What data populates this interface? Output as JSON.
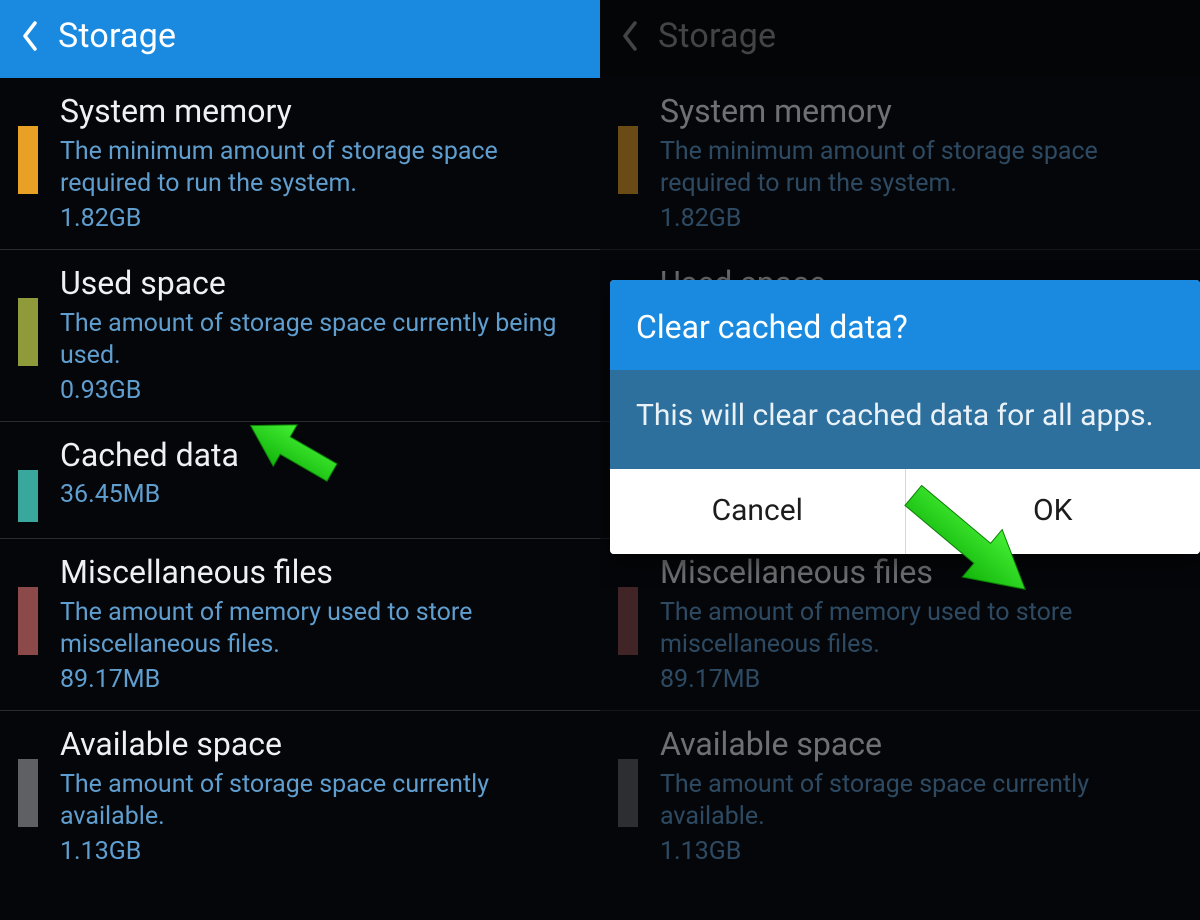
{
  "header": {
    "title": "Storage"
  },
  "rows": [
    {
      "title": "System memory",
      "desc": "The minimum amount of storage space required to run the system.",
      "size": "1.82GB",
      "color": "c-orange",
      "tall": true
    },
    {
      "title": "Used space",
      "desc": "The amount of storage space currently being used.",
      "size": "0.93GB",
      "color": "c-olive",
      "tall": true
    },
    {
      "title": "Cached data",
      "desc": "",
      "size": "36.45MB",
      "color": "c-teal",
      "tall": false
    },
    {
      "title": "Miscellaneous files",
      "desc": "The amount of memory used to store miscellaneous files.",
      "size": "89.17MB",
      "color": "c-brick",
      "tall": true
    },
    {
      "title": "Available space",
      "desc": "The amount of storage space currently available.",
      "size": "1.13GB",
      "color": "c-gray",
      "tall": true
    }
  ],
  "dialog": {
    "title": "Clear cached data?",
    "body": "This will clear cached data for all apps.",
    "cancel": "Cancel",
    "ok": "OK"
  },
  "colors": {
    "accent": "#1a8ae1",
    "link": "#5f9ecf",
    "arrow": "#2ad81f"
  }
}
